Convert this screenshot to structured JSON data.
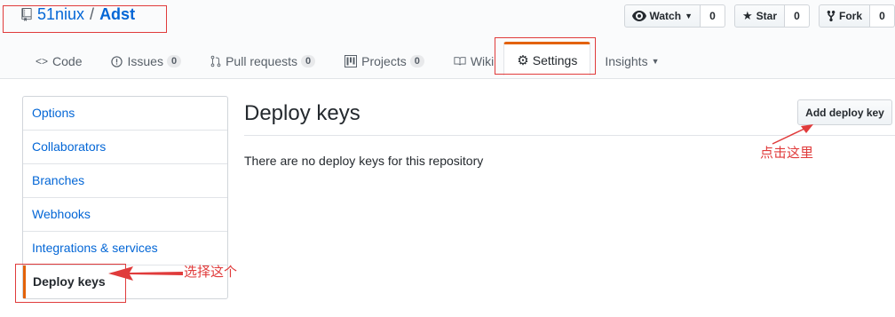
{
  "repo": {
    "owner": "51niux",
    "separator": "/",
    "name": "Adst"
  },
  "actions": {
    "watch": {
      "label": "Watch",
      "count": "0"
    },
    "star": {
      "label": "Star",
      "count": "0"
    },
    "fork": {
      "label": "Fork",
      "count": "0"
    }
  },
  "tabs": {
    "code": {
      "label": "Code"
    },
    "issues": {
      "label": "Issues",
      "count": "0"
    },
    "pulls": {
      "label": "Pull requests",
      "count": "0"
    },
    "projects": {
      "label": "Projects",
      "count": "0"
    },
    "wiki": {
      "label": "Wiki"
    },
    "settings": {
      "label": "Settings"
    },
    "insights": {
      "label": "Insights"
    }
  },
  "sidebar": {
    "items": [
      {
        "label": "Options"
      },
      {
        "label": "Collaborators"
      },
      {
        "label": "Branches"
      },
      {
        "label": "Webhooks"
      },
      {
        "label": "Integrations & services"
      },
      {
        "label": "Deploy keys"
      }
    ]
  },
  "main": {
    "title": "Deploy keys",
    "add_button": "Add deploy key",
    "empty_message": "There are no deploy keys for this repository"
  },
  "annotations": {
    "click_here": "点击这里",
    "select_this": "选择这个",
    "color": "#e03b3b"
  },
  "colors": {
    "link": "#0366d6",
    "accent": "#e36209"
  }
}
